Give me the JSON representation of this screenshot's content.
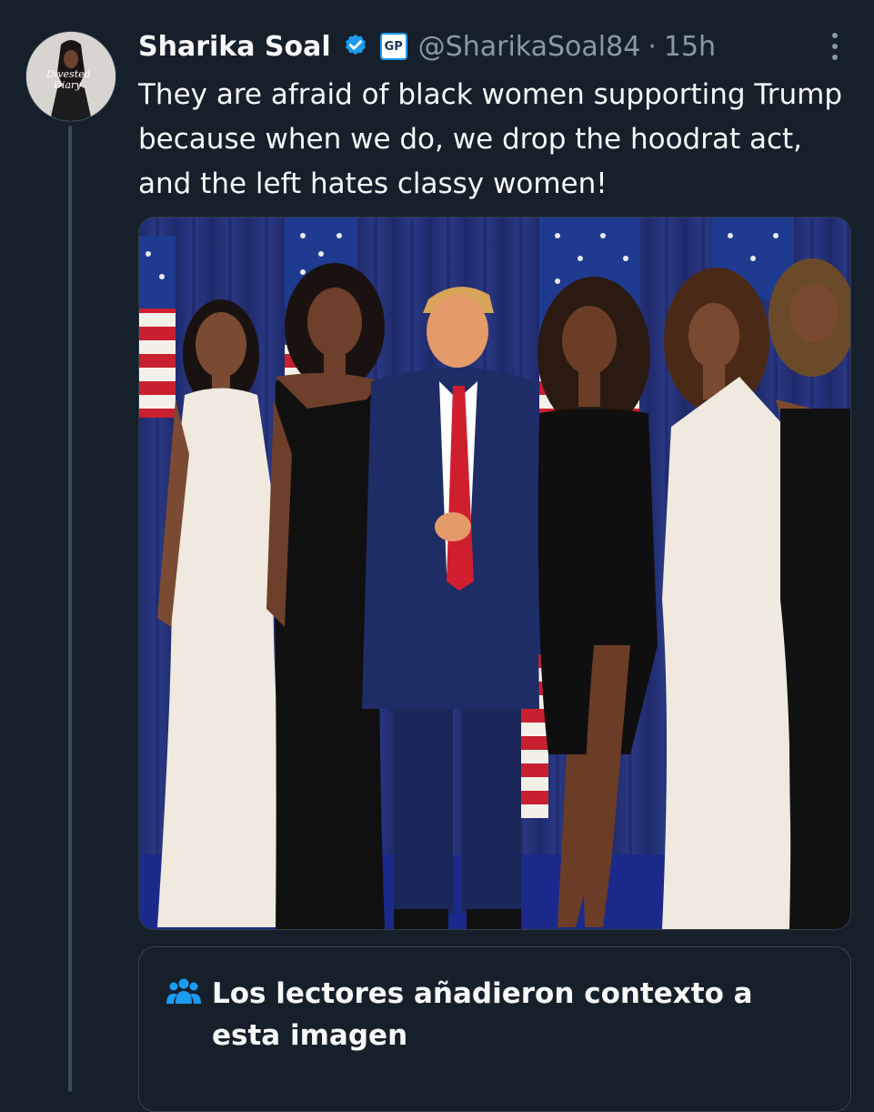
{
  "tweet": {
    "author_name": "Sharika Soal",
    "badge_label": "GP",
    "handle": "@SharikaSoal84",
    "separator": "·",
    "time": "15h",
    "text": "They are afraid of black women supporting Trump because when we do, we drop the hoodrat act, and the left hates classy women!"
  },
  "avatar": {
    "text_line1": "Divested",
    "text_line2": "Diary"
  },
  "community_note": {
    "title": "Los lectores añadieron contexto a esta imagen"
  },
  "colors": {
    "background": "#15202b",
    "text": "#f7f9f9",
    "muted": "#8b98a5",
    "accent": "#1d9bf0",
    "border": "#38444d"
  },
  "icons": [
    "verified-badge-icon",
    "gp-affiliate-badge",
    "more-options-icon",
    "people-icon"
  ]
}
